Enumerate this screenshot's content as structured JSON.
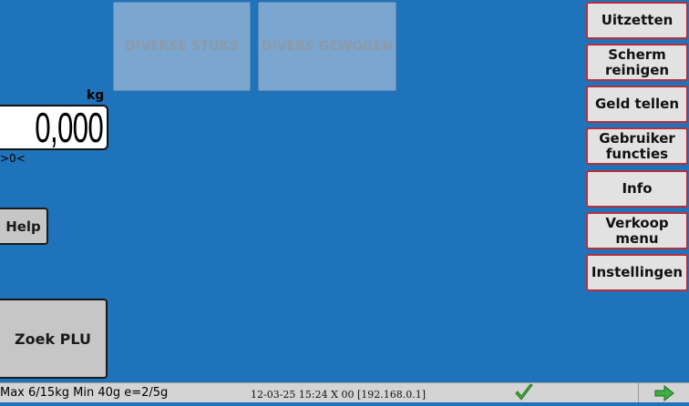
{
  "tiles": [
    {
      "label": "DIVERSE STUKS"
    },
    {
      "label": "DIVERS GEWOGEN"
    }
  ],
  "scale": {
    "unit": "kg",
    "weight": "0,000",
    "zero_indicator": ">0<"
  },
  "left_buttons": {
    "help": "Help",
    "zoek_plu": "Zoek PLU"
  },
  "side_menu": [
    {
      "label": "Uitzetten"
    },
    {
      "label": "Scherm reinigen"
    },
    {
      "label": "Geld tellen"
    },
    {
      "label": "Gebruiker functies"
    },
    {
      "label": "Info"
    },
    {
      "label": "Verkoop menu"
    },
    {
      "label": "Instellingen"
    }
  ],
  "status_bar": {
    "capacity": "Max 6/15kg Min 40g e=2/5g",
    "info": "12-03-25 15:24 X 00 [192.168.0.1]",
    "ok_icon": "check-icon",
    "next_icon": "arrow-right-icon"
  },
  "colors": {
    "background": "#1f73ba",
    "menu_border": "#b6303b",
    "check_green": "#3fa63a",
    "arrow_green": "#3cb043"
  }
}
